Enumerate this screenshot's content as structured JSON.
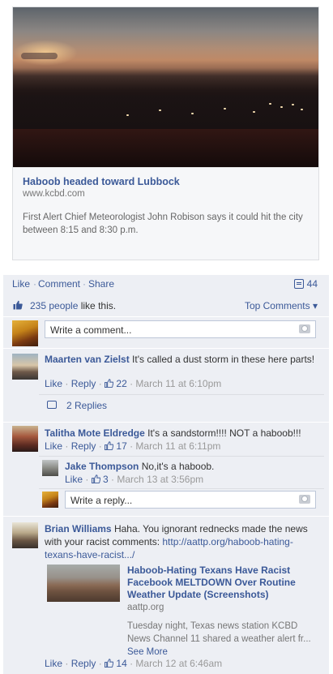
{
  "link_card": {
    "title": "Haboob headed toward Lubbock",
    "domain": "www.kcbd.com",
    "description": "First Alert Chief Meteorologist John Robison says it could hit the city between 8:15 and 8:30 p.m."
  },
  "actions": {
    "like": "Like",
    "comment": "Comment",
    "share": "Share",
    "separator": "·",
    "comment_count": "44"
  },
  "likes": {
    "count_text": "235 people",
    "suffix": " like this.",
    "sort_label": "Top Comments ▾"
  },
  "composer": {
    "placeholder": "Write a comment..."
  },
  "comments": [
    {
      "name": "Maarten van Zielst",
      "text": "It's called a dust storm in these here parts!",
      "like": "Like",
      "reply": "Reply",
      "likes": "22",
      "time": "March 11 at 6:10pm",
      "replies_link": "2 Replies"
    },
    {
      "name": "Talitha Mote Eldredge",
      "text": "It's a sandstorm!!!! NOT a haboob!!!",
      "like": "Like",
      "reply": "Reply",
      "likes": "17",
      "time": "March 11 at 6:11pm",
      "reply_items": [
        {
          "name": "Jake Thompson",
          "text": "No,it's a haboob.",
          "like": "Like",
          "likes": "3",
          "time": "March 13 at 3:56pm"
        }
      ],
      "reply_placeholder": "Write a reply..."
    },
    {
      "name": "Brian Williams",
      "text_before_link": "Haha. You ignorant rednecks made the news with your racist comments: ",
      "link_text": "http://aattp.org/haboob-hating-texans-have-racist.../",
      "attachment": {
        "title": "Haboob-Hating Texans Have Racist Facebook MELTDOWN Over Routine Weather Update (Screenshots)",
        "domain": "aattp.org",
        "description": "Tuesday night, Texas news station KCBD News Channel 11 shared a weather alert fr...",
        "see_more": "See More"
      },
      "like": "Like",
      "reply": "Reply",
      "likes": "14",
      "time": "March 12 at 6:46am"
    }
  ]
}
